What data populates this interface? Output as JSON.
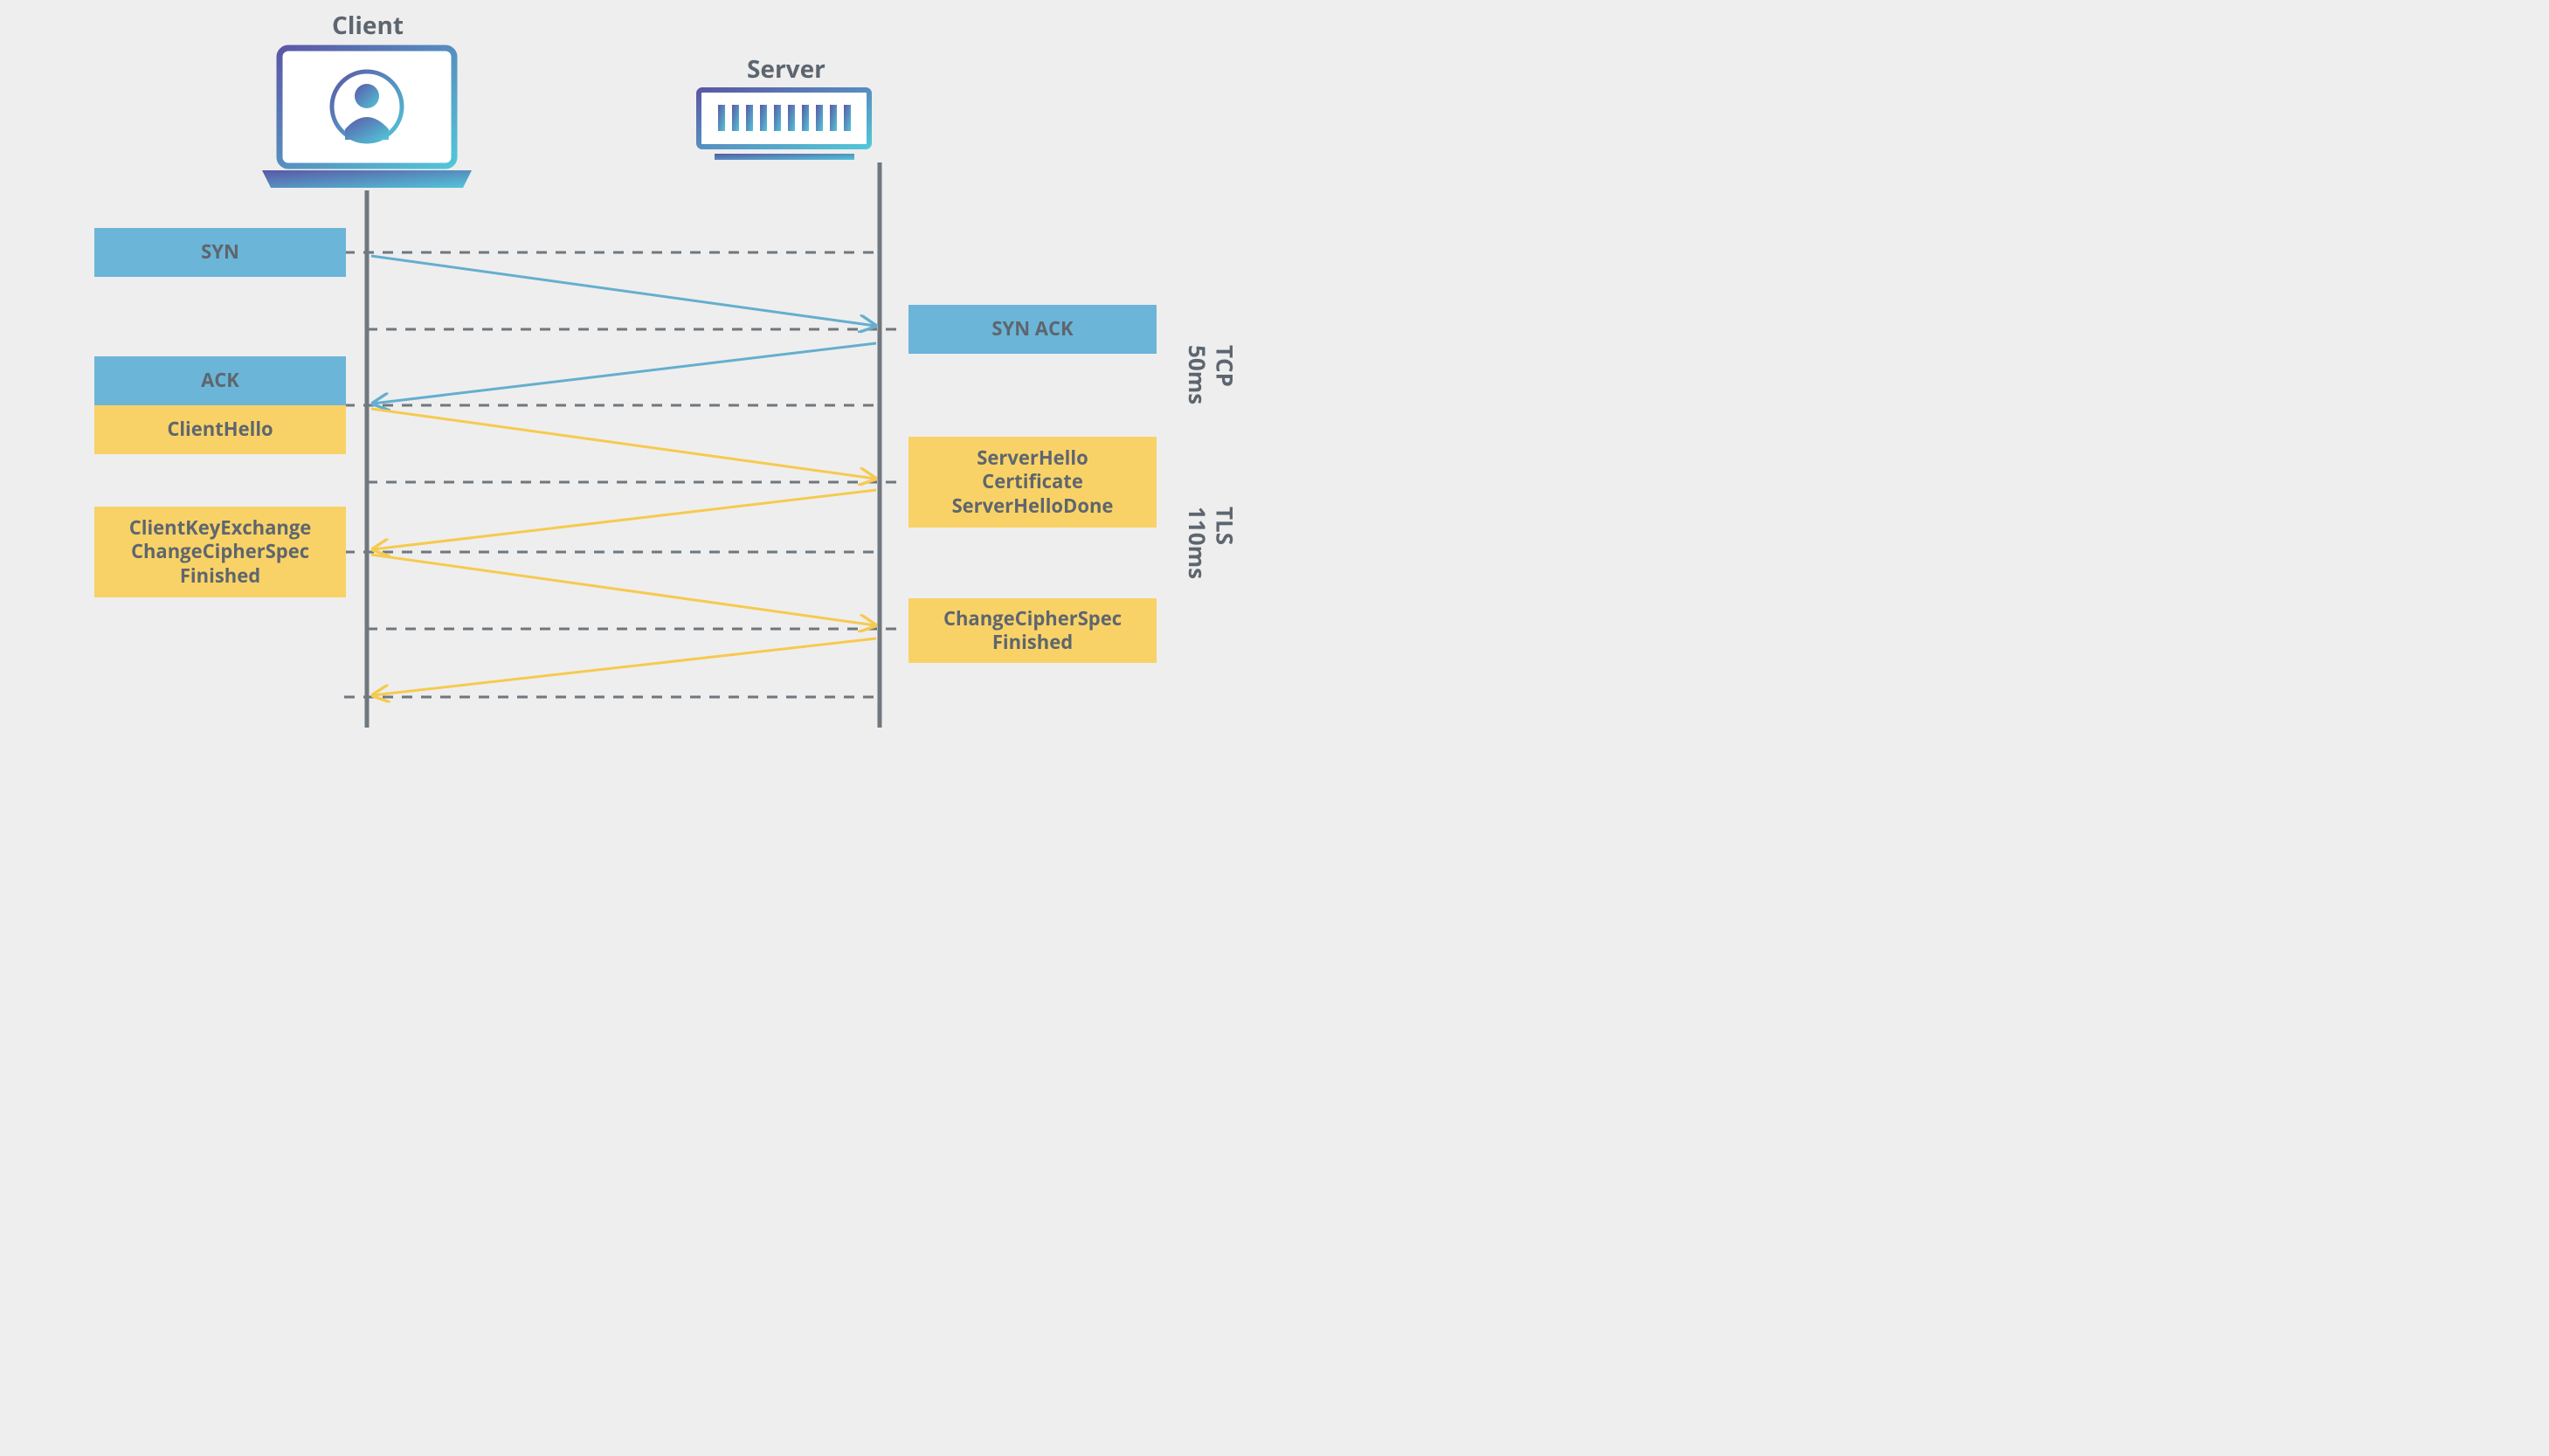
{
  "titles": {
    "client": "Client",
    "server": "Server"
  },
  "messages": {
    "syn": "SYN",
    "synack": "SYN ACK",
    "ack": "ACK",
    "clienthello": "ClientHello",
    "serverhello": "ServerHello\nCertificate\nServerHelloDone",
    "clientkey": "ClientKeyExchange\nChangeCipherSpec\nFinished",
    "serverfinish": "ChangeCipherSpec\nFinished"
  },
  "sidelabels": {
    "tcp": "TCP\n50ms",
    "tls": "TLS\n110ms"
  },
  "colors": {
    "tcp_box": "#6bb5d8",
    "tls_box": "#f9d267",
    "text": "#5e666e",
    "tcp_arrow": "#65aecf",
    "tls_arrow": "#f6ca4f",
    "dash": "#6f777f",
    "lifeline": "#6f777f"
  }
}
